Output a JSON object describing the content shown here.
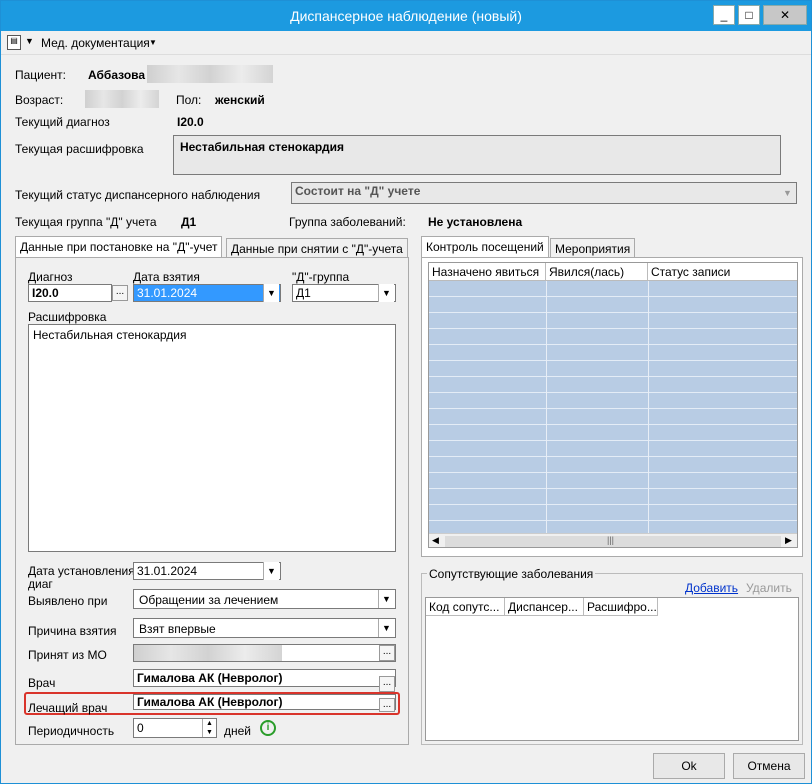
{
  "window": {
    "title": "Диспансерное наблюдение (новый)",
    "controls": [
      "_",
      "□",
      "✕"
    ]
  },
  "menu": {
    "doc_icon": "document-icon",
    "label": "Мед. документация"
  },
  "patient": {
    "label_patient": "Пациент:",
    "name": "Аббазова",
    "label_age": "Возраст:",
    "label_sex": "Пол:",
    "sex": "женский",
    "label_diag": "Текущий диагноз",
    "diag": "I20.0",
    "label_decode": "Текущая расшифровка",
    "decode": "Нестабильная стенокардия",
    "label_status": "Текущий статус диспансерного наблюдения",
    "status": "Состоит на \"Д\" учете",
    "label_group": "Текущая группа \"Д\" учета",
    "group": "Д1",
    "label_disease_group": "Группа заболеваний:",
    "disease_group": "Не установлена"
  },
  "left_tabs": [
    "Данные при постановке на \"Д\"-учет",
    "Данные при снятии с \"Д\"-учета"
  ],
  "left": {
    "label_diagnosis": "Диагноз",
    "diagnosis": "I20.0",
    "label_date_taken": "Дата взятия",
    "date_taken": "31.01.2024",
    "label_dgroup": "\"Д\"-группа",
    "dgroup": "Д1",
    "label_decode": "Расшифровка",
    "decode": "Нестабильная стенокардия",
    "label_date_set": "Дата установления диаг",
    "date_set": "31.01.2024",
    "label_detected": "Выявлено при",
    "detected": "Обращении за лечением",
    "label_reason": "Причина взятия",
    "reason": "Взят впервые",
    "label_from_mo": "Принят из МО",
    "label_doctor": "Врач",
    "doctor": "Гималова АК (Невролог)",
    "label_treating": "Лечащий врач",
    "treating": "Гималова АК (Невролог)",
    "label_period": "Периодичность",
    "period": "0",
    "period_unit": "дней"
  },
  "right_tabs": [
    "Контроль посещений",
    "Мероприятия"
  ],
  "visits_columns": [
    "Назначено явиться",
    "Явился(лась)",
    "Статус записи"
  ],
  "comorbid": {
    "title": "Сопутствующие заболевания",
    "add": "Добавить",
    "remove": "Удалить",
    "columns": [
      "Код сопутс...",
      "Диспансер...",
      "Расшифро..."
    ]
  },
  "buttons": {
    "ok": "Ok",
    "cancel": "Отмена"
  },
  "colors": {
    "titlebar": "#1c9ae0",
    "grid_fill": "#b8cce4",
    "highlight": "#d9342b"
  }
}
